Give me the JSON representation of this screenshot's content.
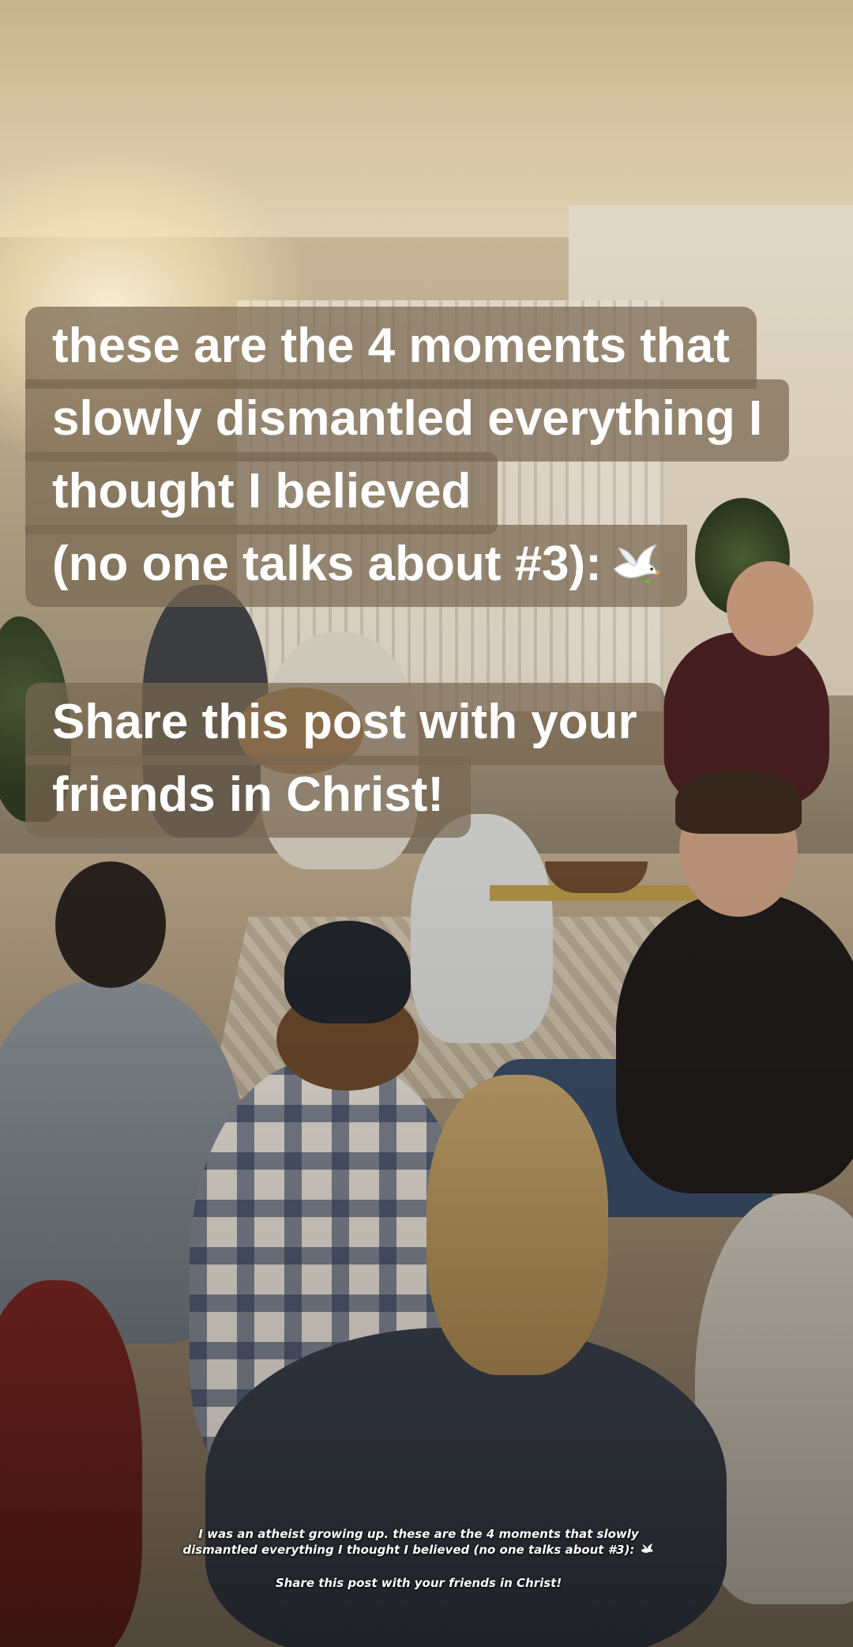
{
  "overlay": {
    "headline_lines": [
      "these are the 4 moments that",
      "slowly dismantled everything I",
      "thought I believed",
      "(no one talks about #3):"
    ],
    "headline_emoji": "dove-icon",
    "cta_lines": [
      "Share this post with your",
      "friends in Christ!"
    ]
  },
  "description": {
    "line1": "I was an atheist growing up. these are the 4 moments that slowly",
    "line2": "dismantled everything I thought I believed (no one talks about #3):",
    "emoji": "dove-icon",
    "share_line": "Share this post with your friends in Christ!"
  },
  "colors": {
    "caption_background": "#786852",
    "caption_text": "#ffffff"
  }
}
